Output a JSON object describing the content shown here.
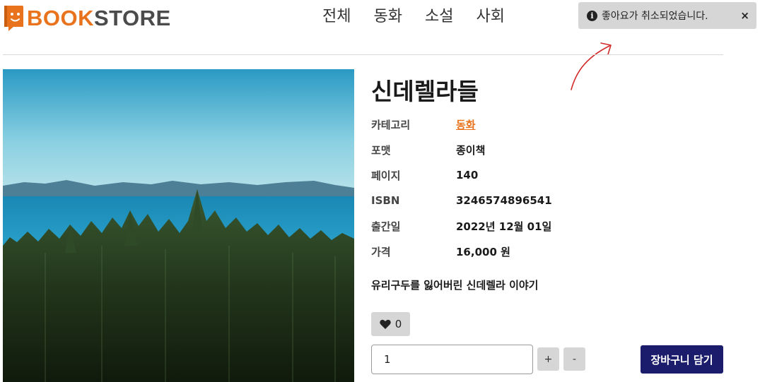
{
  "brand": {
    "name_part1": "BOOK",
    "name_part2": "STORE",
    "accent_color": "#e8731c",
    "text_color": "#4b4b4b"
  },
  "nav": {
    "items": [
      {
        "label": "전체"
      },
      {
        "label": "동화"
      },
      {
        "label": "소설"
      },
      {
        "label": "사회"
      }
    ]
  },
  "toast": {
    "icon": "info-icon",
    "message": "좋아요가 취소되었습니다.",
    "close_label": "×",
    "background": "#d6d6d6"
  },
  "book": {
    "title": "신데렐라들",
    "details": [
      {
        "key": "카테고리",
        "value": "동화",
        "is_link": true
      },
      {
        "key": "포맷",
        "value": "종이책"
      },
      {
        "key": "페이지",
        "value": "140"
      },
      {
        "key": "ISBN",
        "value": "3246574896541"
      },
      {
        "key": "출간일",
        "value": "2022년 12월 01일"
      },
      {
        "key": "가격",
        "value": "16,000 원"
      }
    ],
    "summary": "유리구두를 잃어버린 신데렐라 이야기",
    "cover_image": "landscape-photo: forest, sea, mountains"
  },
  "actions": {
    "like_icon": "heart-icon",
    "like_count": "0",
    "quantity_value": "1",
    "plus_label": "+",
    "minus_label": "-",
    "cart_label": "장바구니 담기",
    "cart_color": "#1b1c6b"
  }
}
